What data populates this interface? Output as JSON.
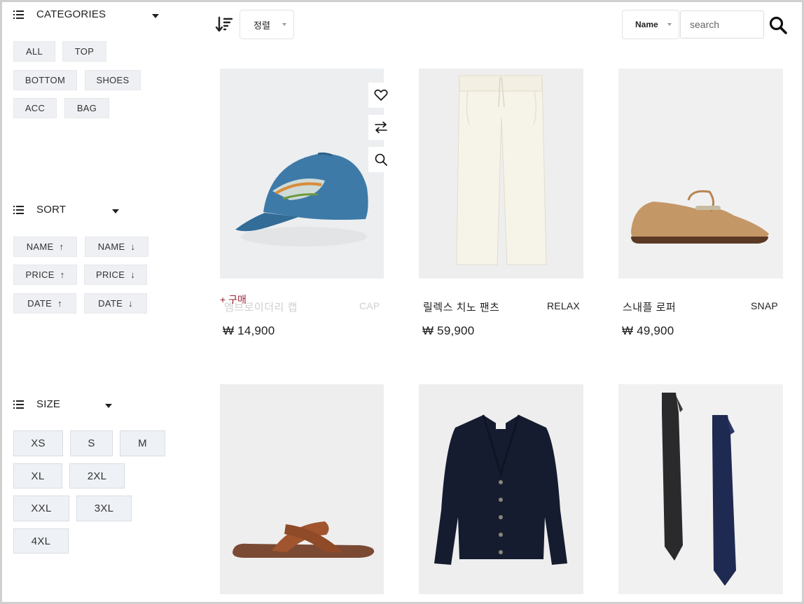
{
  "sidebar": {
    "categories": {
      "title": "CATEGORIES",
      "items": [
        "ALL",
        "TOP",
        "BOTTOM",
        "SHOES",
        "ACC",
        "BAG"
      ]
    },
    "sort": {
      "title": "SORT",
      "items": [
        {
          "label": "NAME",
          "arrow": "↑"
        },
        {
          "label": "NAME",
          "arrow": "↓"
        },
        {
          "label": "PRICE",
          "arrow": "↑"
        },
        {
          "label": "PRICE",
          "arrow": "↓"
        },
        {
          "label": "DATE",
          "arrow": "↑"
        },
        {
          "label": "DATE",
          "arrow": "↓"
        }
      ]
    },
    "size": {
      "title": "SIZE",
      "items": [
        "XS",
        "S",
        "M",
        "XL",
        "2XL",
        "XXL",
        "3XL",
        "4XL"
      ]
    }
  },
  "toolbar": {
    "sort_select": "정렬",
    "field_select": "Name",
    "search_placeholder": "search"
  },
  "products": [
    {
      "name": "엠브로이더리 캡",
      "tag": "CAP",
      "price": "₩ 14,900",
      "buy_label": "+ 구매"
    },
    {
      "name": "릴렉스 치노 팬츠",
      "tag": "RELAX",
      "price": "₩ 59,900"
    },
    {
      "name": "스내플 로퍼",
      "tag": "SNAP",
      "price": "₩ 49,900"
    },
    {
      "name": "",
      "tag": "",
      "price": ""
    },
    {
      "name": "",
      "tag": "",
      "price": ""
    },
    {
      "name": "",
      "tag": "",
      "price": ""
    }
  ],
  "colors": {
    "chip_bg": "#eef0f3",
    "buy_accent": "#9b2335",
    "image_bg": "#f1f1f1"
  }
}
